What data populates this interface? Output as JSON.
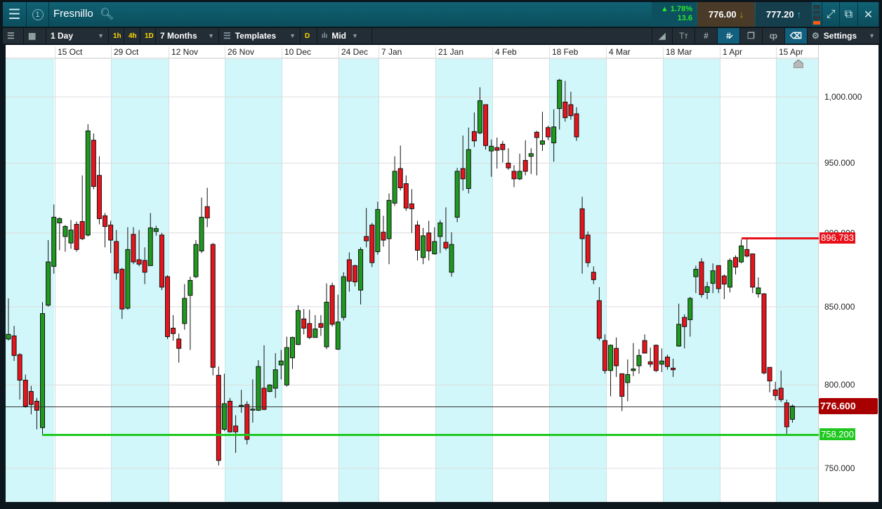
{
  "header": {
    "title": "Fresnillo",
    "info_badge": "1",
    "change_pct": "▲ 1.78%",
    "change_abs": "13.6",
    "sell_price": "776.00",
    "buy_price": "777.20"
  },
  "toolbar": {
    "interval": "1 Day",
    "quick_intervals": [
      "1h",
      "4h",
      "1D"
    ],
    "range": "7 Months",
    "templates": "Templates",
    "d_button": "D",
    "price_type": "Mid",
    "settings": "Settings"
  },
  "colors": {
    "up": "#1e9a1e",
    "down": "#e8141c",
    "shade": "#d2f7fa",
    "support": "#1ec81e",
    "resistance": "#e8111a",
    "current": "#a80000"
  },
  "chart_data": {
    "type": "candlestick",
    "title": "Fresnillo",
    "interval": "1 Day",
    "scale": "log",
    "x_tick_labels": [
      "15 Oct",
      "29 Oct",
      "12 Nov",
      "26 Nov",
      "10 Dec",
      "24 Dec",
      "7 Jan",
      "21 Jan",
      "4 Feb",
      "18 Feb",
      "4 Mar",
      "18 Mar",
      "1 Apr",
      "15 Apr"
    ],
    "y_tick_labels": [
      "1,000.000",
      "950.000",
      "900.000",
      "850.000",
      "800.000",
      "750.000"
    ],
    "y_ticks": [
      1000,
      950,
      900,
      850,
      800,
      750
    ],
    "ylim": [
      730.7,
      1029.8
    ],
    "current_price": "776.600",
    "resistance_line": "896.783",
    "support_line": "758.200",
    "ohlc_columns": [
      "open",
      "high",
      "low",
      "close"
    ],
    "candles": [
      [
        829,
        855.5,
        828,
        832
      ],
      [
        831,
        837.5,
        815,
        818.5
      ],
      [
        819,
        820,
        791,
        803
      ],
      [
        803,
        806.5,
        786,
        787
      ],
      [
        796,
        799.5,
        782,
        788
      ],
      [
        790,
        792,
        773,
        784.5
      ],
      [
        774,
        853,
        769,
        845.5
      ],
      [
        851,
        895,
        850,
        880
      ],
      [
        877,
        920,
        872,
        911
      ],
      [
        907,
        911,
        888,
        910
      ],
      [
        897.5,
        905.5,
        887,
        904.5
      ],
      [
        893,
        909,
        889,
        902
      ],
      [
        906,
        908,
        887,
        888.5
      ],
      [
        908,
        941,
        895,
        896
      ],
      [
        898.5,
        979,
        897.5,
        974
      ],
      [
        967,
        972,
        931,
        933
      ],
      [
        941,
        955,
        906,
        910
      ],
      [
        912,
        914,
        890,
        904.5
      ],
      [
        905.5,
        908.5,
        886,
        895
      ],
      [
        894,
        902,
        868,
        872.5
      ],
      [
        875,
        876,
        842,
        848.5
      ],
      [
        849,
        904,
        848,
        888.5
      ],
      [
        899,
        904,
        878.5,
        880
      ],
      [
        881.5,
        902,
        877,
        878.5
      ],
      [
        881,
        890,
        865,
        873
      ],
      [
        877.5,
        914,
        877.5,
        903.5
      ],
      [
        901,
        905,
        898,
        903
      ],
      [
        898.5,
        900,
        861,
        863
      ],
      [
        870,
        871,
        829,
        830.5
      ],
      [
        836,
        844.5,
        828,
        832.5
      ],
      [
        829,
        832.5,
        814,
        823
      ],
      [
        839,
        865,
        835,
        855.5
      ],
      [
        857.5,
        870,
        822,
        867.5
      ],
      [
        870,
        895,
        869,
        892
      ],
      [
        887.5,
        925,
        886,
        911
      ],
      [
        918.5,
        932,
        904,
        910.5
      ],
      [
        892,
        893,
        806,
        811
      ],
      [
        806,
        811.5,
        751.7,
        754.6
      ],
      [
        773,
        807,
        772,
        788.5
      ],
      [
        790,
        792,
        771,
        771.5
      ],
      [
        775,
        781.5,
        759,
        771.5
      ],
      [
        787,
        797,
        783,
        787.5
      ],
      [
        788,
        790,
        764,
        767
      ],
      [
        785,
        803.5,
        777,
        785.2
      ],
      [
        784.5,
        815.5,
        784,
        811.5
      ],
      [
        798,
        825,
        784.5,
        785
      ],
      [
        796,
        800.5,
        795.5,
        800
      ],
      [
        798,
        820,
        792,
        809.5
      ],
      [
        812.5,
        822,
        803.5,
        815
      ],
      [
        800,
        830.5,
        799,
        823.5
      ],
      [
        817,
        830.5,
        810,
        830
      ],
      [
        825.5,
        851,
        825,
        847.5
      ],
      [
        842,
        848.5,
        832,
        836
      ],
      [
        839,
        848,
        829,
        830
      ],
      [
        830,
        844.5,
        830,
        835.5
      ],
      [
        839,
        844.5,
        831,
        836.5
      ],
      [
        824,
        865.5,
        822.5,
        853
      ],
      [
        864,
        866,
        837,
        838.5
      ],
      [
        822.5,
        858,
        822,
        840
      ],
      [
        843,
        873,
        841,
        870
      ],
      [
        881.5,
        886.5,
        860,
        867
      ],
      [
        877.5,
        878,
        863.5,
        866.5
      ],
      [
        861,
        890,
        851.5,
        888.5
      ],
      [
        897.5,
        917.5,
        890,
        894.5
      ],
      [
        905.5,
        907,
        876.5,
        879.5
      ],
      [
        887,
        922,
        885,
        916.5
      ],
      [
        900.5,
        912,
        890.5,
        895
      ],
      [
        896,
        928,
        878.5,
        923
      ],
      [
        921,
        955,
        919,
        944
      ],
      [
        946,
        963,
        930,
        932
      ],
      [
        935,
        941,
        915.5,
        917.5
      ],
      [
        920.5,
        931,
        900,
        917
      ],
      [
        905.5,
        908.5,
        881,
        888
      ],
      [
        883,
        903.5,
        878.5,
        898
      ],
      [
        900,
        908.5,
        881,
        887.5
      ],
      [
        885.5,
        904,
        885,
        894
      ],
      [
        897.5,
        909,
        886,
        907
      ],
      [
        893.5,
        918,
        888,
        889.5
      ],
      [
        873,
        900.5,
        870,
        892
      ],
      [
        911,
        946.5,
        907.5,
        944
      ],
      [
        946,
        970.5,
        930,
        938.5
      ],
      [
        931.5,
        976.5,
        928,
        960
      ],
      [
        973.5,
        988,
        962,
        966.5
      ],
      [
        972.5,
        1007.5,
        971.5,
        997
      ],
      [
        994,
        994,
        960,
        963
      ],
      [
        959,
        967.5,
        940,
        962.5
      ],
      [
        961.5,
        969,
        946,
        959.5
      ],
      [
        964,
        966.5,
        950.5,
        960
      ],
      [
        950,
        961,
        945,
        946.5
      ],
      [
        944,
        948.5,
        932.5,
        938.5
      ],
      [
        938.5,
        957,
        937.5,
        944
      ],
      [
        952,
        967,
        941,
        944
      ],
      [
        955,
        961,
        942,
        957
      ],
      [
        973,
        974,
        941,
        969
      ],
      [
        964,
        988.5,
        959,
        966.5
      ],
      [
        976.5,
        978,
        967,
        969.5
      ],
      [
        965,
        990.5,
        951,
        977
      ],
      [
        991,
        1014,
        975,
        1013
      ],
      [
        996,
        1012.5,
        981,
        984
      ],
      [
        994,
        1004,
        982.5,
        985.5
      ],
      [
        987,
        992,
        966.5,
        969.5
      ],
      [
        917,
        925.5,
        872,
        896
      ],
      [
        898.5,
        901,
        876.5,
        879.5
      ],
      [
        873,
        877,
        865,
        868
      ],
      [
        854,
        863,
        828,
        829.5
      ],
      [
        828,
        832,
        807,
        809
      ],
      [
        809,
        825.5,
        793,
        825
      ],
      [
        823,
        830,
        805,
        812
      ],
      [
        807,
        807,
        784,
        793
      ],
      [
        801.5,
        816,
        790,
        806.5
      ],
      [
        809,
        826.5,
        805.5,
        810
      ],
      [
        812,
        822.5,
        807,
        818.5
      ],
      [
        828,
        832,
        820,
        820
      ],
      [
        814.5,
        823.5,
        811,
        813
      ],
      [
        825,
        825.5,
        808,
        809
      ],
      [
        813,
        823,
        808,
        815
      ],
      [
        817.5,
        819,
        809.5,
        811.5
      ],
      [
        810.5,
        816.5,
        805,
        809.5
      ],
      [
        824.5,
        852,
        824,
        838.5
      ],
      [
        843,
        845,
        823,
        837
      ],
      [
        841.5,
        856.5,
        830.5,
        855.5
      ],
      [
        870,
        877.5,
        859,
        875
      ],
      [
        880,
        882.5,
        856,
        858
      ],
      [
        859.5,
        866.5,
        855,
        863.3
      ],
      [
        865.5,
        879,
        859,
        874
      ],
      [
        877.5,
        877.5,
        859,
        862
      ],
      [
        870.5,
        871.5,
        855,
        865
      ],
      [
        863,
        882.5,
        859.5,
        881
      ],
      [
        883,
        884.5,
        871.5,
        876.5
      ],
      [
        880,
        895.5,
        879,
        891
      ],
      [
        888.5,
        897,
        883,
        884
      ],
      [
        885.5,
        885.5,
        859,
        863
      ],
      [
        858.5,
        869.5,
        856,
        862.5
      ],
      [
        858.5,
        859,
        806.5,
        807.5
      ],
      [
        811,
        811,
        795.5,
        802.5
      ],
      [
        797,
        802,
        790.5,
        793.5
      ],
      [
        798,
        809,
        789.5,
        791
      ],
      [
        789,
        791,
        770,
        774.5
      ],
      [
        779,
        788,
        777,
        787
      ]
    ]
  }
}
